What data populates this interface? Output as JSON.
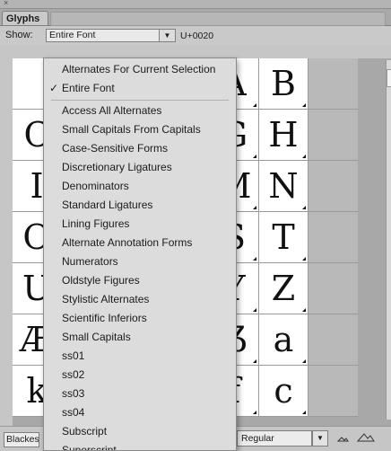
{
  "panel": {
    "close_glyph": "×",
    "tab_label": "Glyphs",
    "tab_menu_glyph": "≡"
  },
  "toolbar": {
    "show_label": "Show:",
    "show_value": "Entire Font",
    "show_arrow": "▼",
    "codepoint": "U+0020"
  },
  "glyph_rows": [
    [
      "",
      "",
      "",
      "",
      "A",
      "B",
      ""
    ],
    [
      "C",
      "",
      "",
      "",
      "G",
      "H",
      ""
    ],
    [
      "I",
      "",
      "",
      "",
      "M",
      "N",
      ""
    ],
    [
      "O",
      "",
      "",
      "",
      "S",
      "T",
      ""
    ],
    [
      "U",
      "",
      "",
      "",
      "Y",
      "Z",
      ""
    ],
    [
      "Æ",
      "",
      "",
      "",
      "ẞ",
      "a",
      ""
    ],
    [
      "k",
      "",
      "",
      "",
      "f",
      "c",
      ""
    ]
  ],
  "menu": {
    "items": [
      {
        "label": "Alternates For Current Selection",
        "checked": false
      },
      {
        "label": "Entire Font",
        "checked": true
      },
      {
        "label": "Access All Alternates",
        "checked": false
      },
      {
        "label": "Small Capitals From Capitals",
        "checked": false
      },
      {
        "label": "Case-Sensitive Forms",
        "checked": false
      },
      {
        "label": "Discretionary Ligatures",
        "checked": false
      },
      {
        "label": "Denominators",
        "checked": false
      },
      {
        "label": "Standard Ligatures",
        "checked": false
      },
      {
        "label": "Lining Figures",
        "checked": false
      },
      {
        "label": "Alternate Annotation Forms",
        "checked": false
      },
      {
        "label": "Numerators",
        "checked": false
      },
      {
        "label": "Oldstyle Figures",
        "checked": false
      },
      {
        "label": "Stylistic Alternates",
        "checked": false
      },
      {
        "label": "Scientific Inferiors",
        "checked": false
      },
      {
        "label": "Small Capitals",
        "checked": false
      },
      {
        "label": "ss01",
        "checked": false
      },
      {
        "label": "ss02",
        "checked": false
      },
      {
        "label": "ss03",
        "checked": false
      },
      {
        "label": "ss04",
        "checked": false
      },
      {
        "label": "Subscript",
        "checked": false
      },
      {
        "label": "Superscript",
        "checked": false
      }
    ],
    "check_glyph": "✓"
  },
  "bottom": {
    "font_value": "Blackest",
    "style_value": "Regular",
    "style_arrow": "▼"
  },
  "icons": {
    "zoom_out": "small-mountains-icon",
    "zoom_in": "large-mountains-icon"
  }
}
